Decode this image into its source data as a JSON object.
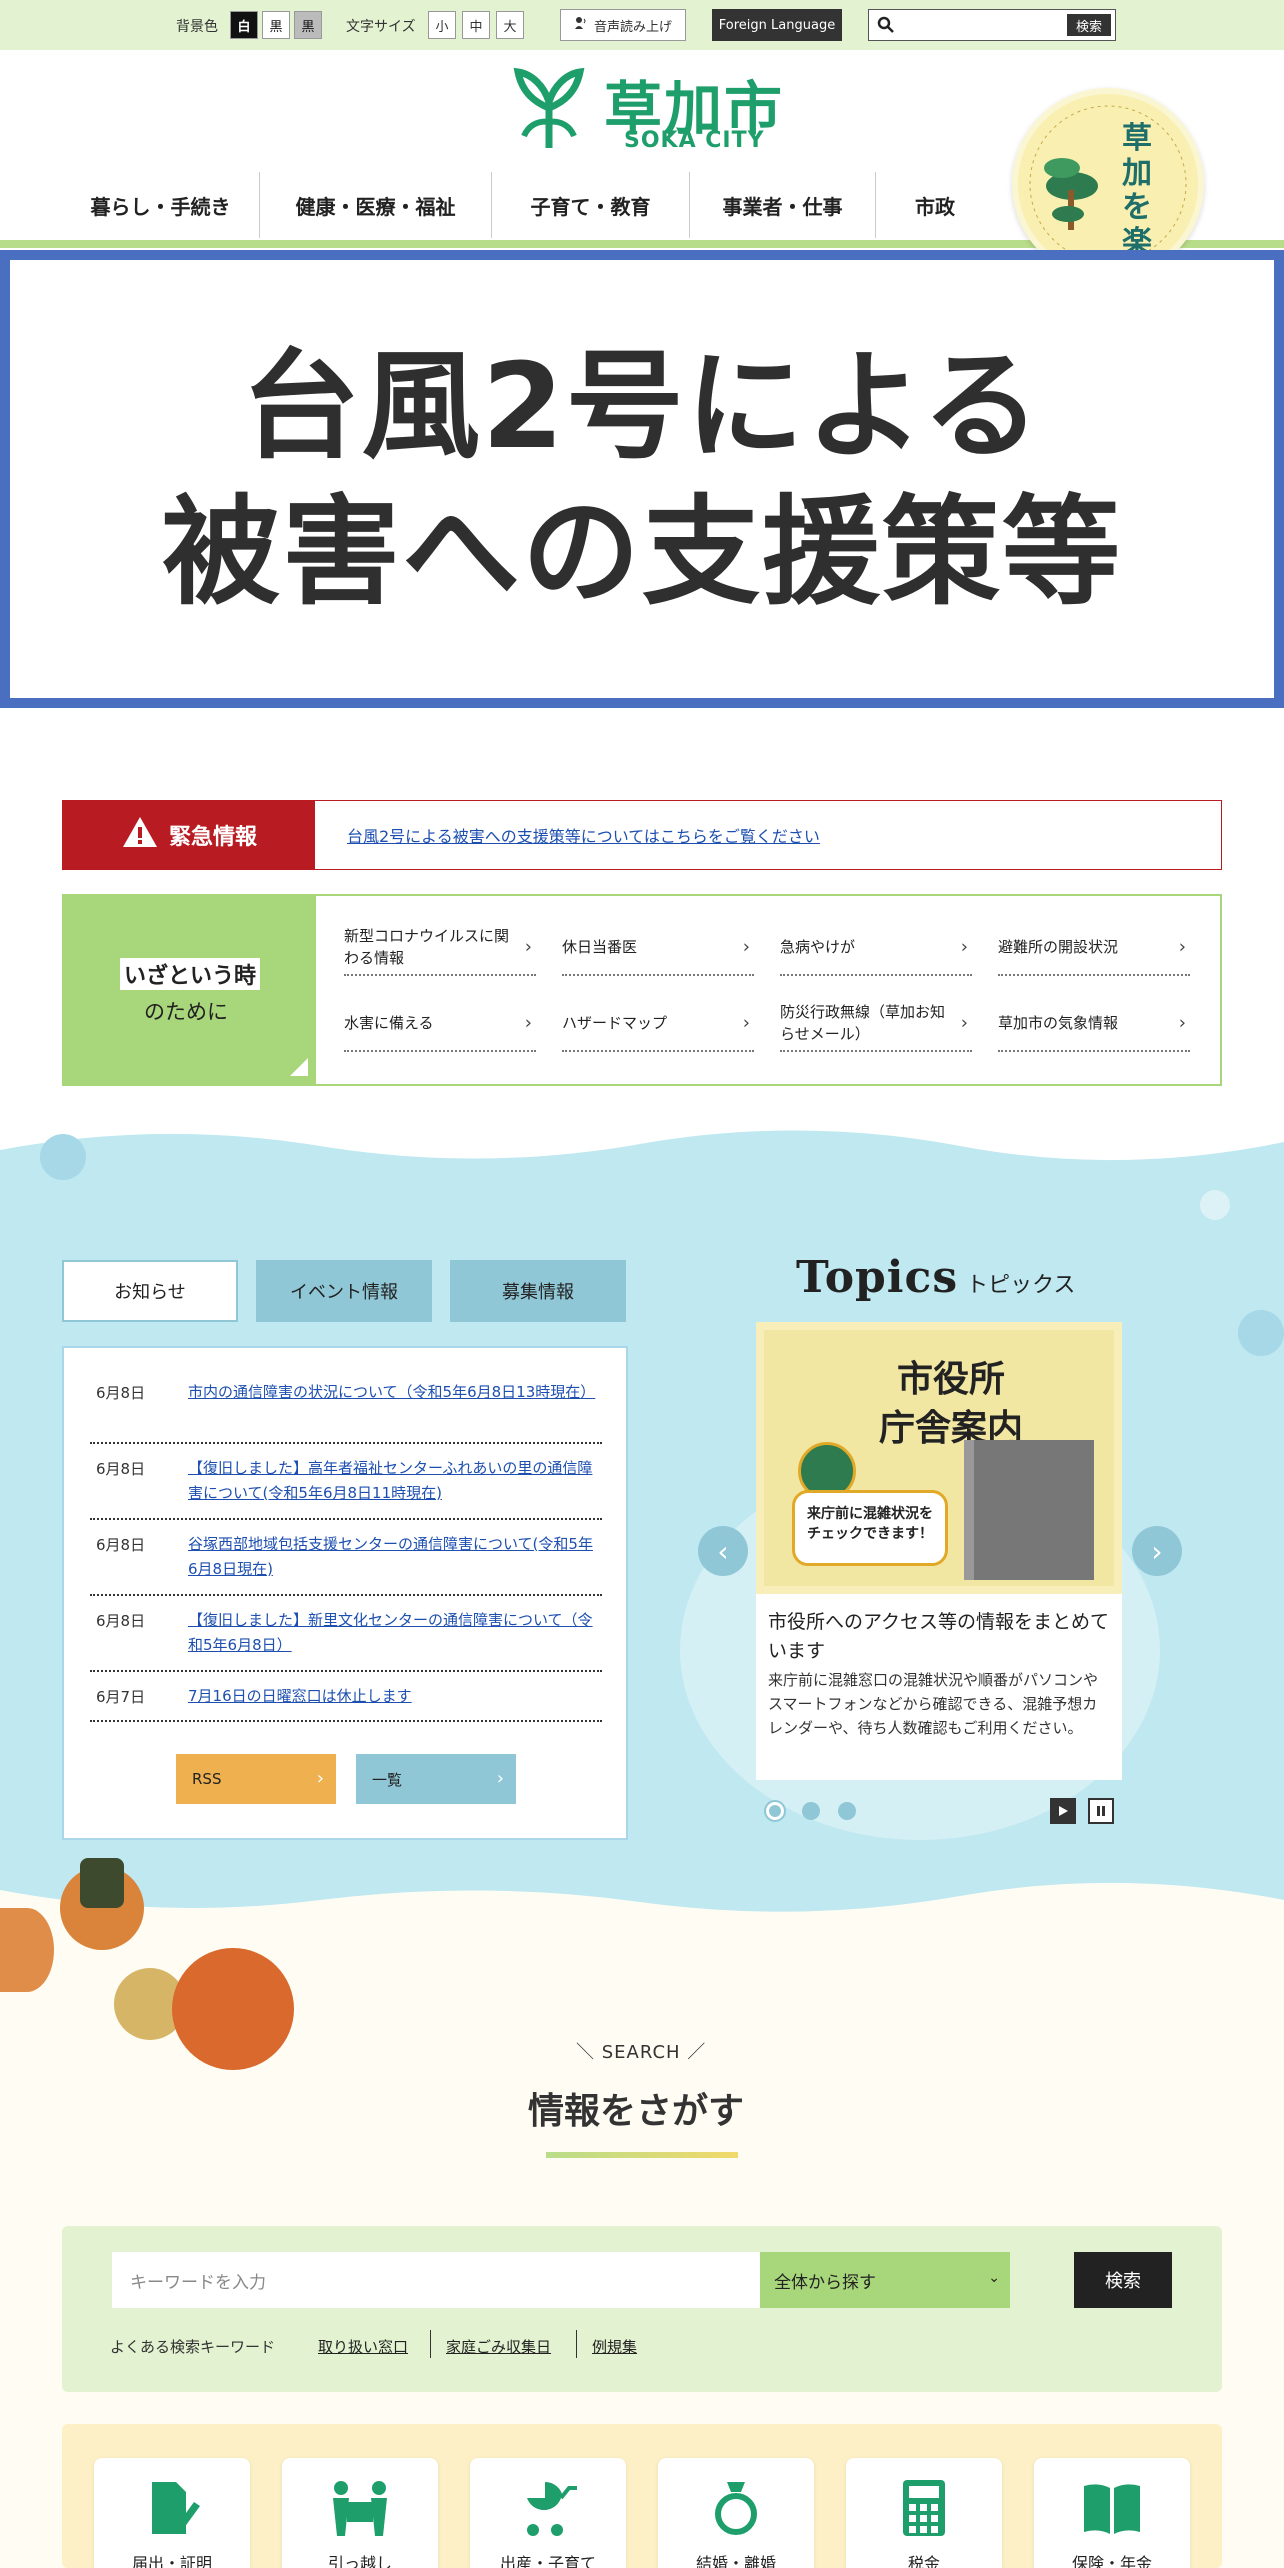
{
  "util": {
    "bg_label": "背景色",
    "bg_options": [
      "白",
      "黒",
      "黒"
    ],
    "size_label": "文字サイズ",
    "size_options": [
      "小",
      "中",
      "大"
    ],
    "speech": "音声読み上げ",
    "foreign": "Foreign Language",
    "search_btn": "検索"
  },
  "header": {
    "logo_jp": "草加市",
    "logo_en": "SOKA CITY",
    "nav": [
      "暮らし・手続き",
      "健康・医療・福祉",
      "子育て・教育",
      "事業者・仕事",
      "市政"
    ],
    "badge_text": "草加を楽しむ"
  },
  "hero": {
    "line1": "台風2号による",
    "line2": "被害への支援策等"
  },
  "emergency": {
    "label": "緊急情報",
    "link": "台風2号による被害への支援策等についてはこちらをご覧ください"
  },
  "disaster": {
    "title1": "いざという時",
    "title2": "のために",
    "links": [
      "新型コロナウイルスに関わる情報",
      "休日当番医",
      "急病やけが",
      "避難所の開設状況",
      "水害に備える",
      "ハザードマップ",
      "防災行政無線（草加お知らせメール）",
      "草加市の気象情報"
    ]
  },
  "news": {
    "tabs": [
      "お知らせ",
      "イベント情報",
      "募集情報"
    ],
    "items": [
      {
        "date": "6月8日",
        "text": "市内の通信障害の状況について（令和5年6月8日13時現在）"
      },
      {
        "date": "6月8日",
        "text": "【復旧しました】高年者福祉センターふれあいの里の通信障害について(令和5年6月8日11時現在)"
      },
      {
        "date": "6月8日",
        "text": "谷塚西部地域包括支援センターの通信障害について(令和5年6月8日現在)"
      },
      {
        "date": "6月8日",
        "text": "【復旧しました】新里文化センターの通信障害について（令和5年6月8日）"
      },
      {
        "date": "6月7日",
        "text": "7月16日の日曜窓口は休止します"
      }
    ],
    "rss": "RSS",
    "list": "一覧"
  },
  "topics": {
    "title_en": "Topics",
    "title_jp": "トピックス",
    "image_title": "市役所\n庁舎案内",
    "image_bubble": "来庁前に混雑状況を\nチェックできます！",
    "caption": "市役所へのアクセス等の情報をまとめています",
    "desc": "来庁前に混雑窓口の混雑状況や順番がパソコンやスマートフォンなどから確認できる、混雑予想カレンダーや、待ち人数確認もご利用ください。"
  },
  "search": {
    "label_en": "SEARCH",
    "heading": "情報をさがす",
    "placeholder": "キーワードを入力",
    "scope": "全体から探す",
    "button": "検索",
    "kw_label": "よくある検索キーワード",
    "keywords": [
      "取り扱い窓口",
      "家庭ごみ収集日",
      "例規集"
    ]
  },
  "categories": [
    "届出・証明",
    "引っ越し",
    "出産・子育て",
    "結婚・離婚",
    "税金",
    "保険・年金"
  ],
  "colors": {
    "accent_green": "#1e9e6a",
    "emergency_red": "#b81c22",
    "hero_border": "#4a6fc0",
    "light_green": "#a8d67a"
  }
}
